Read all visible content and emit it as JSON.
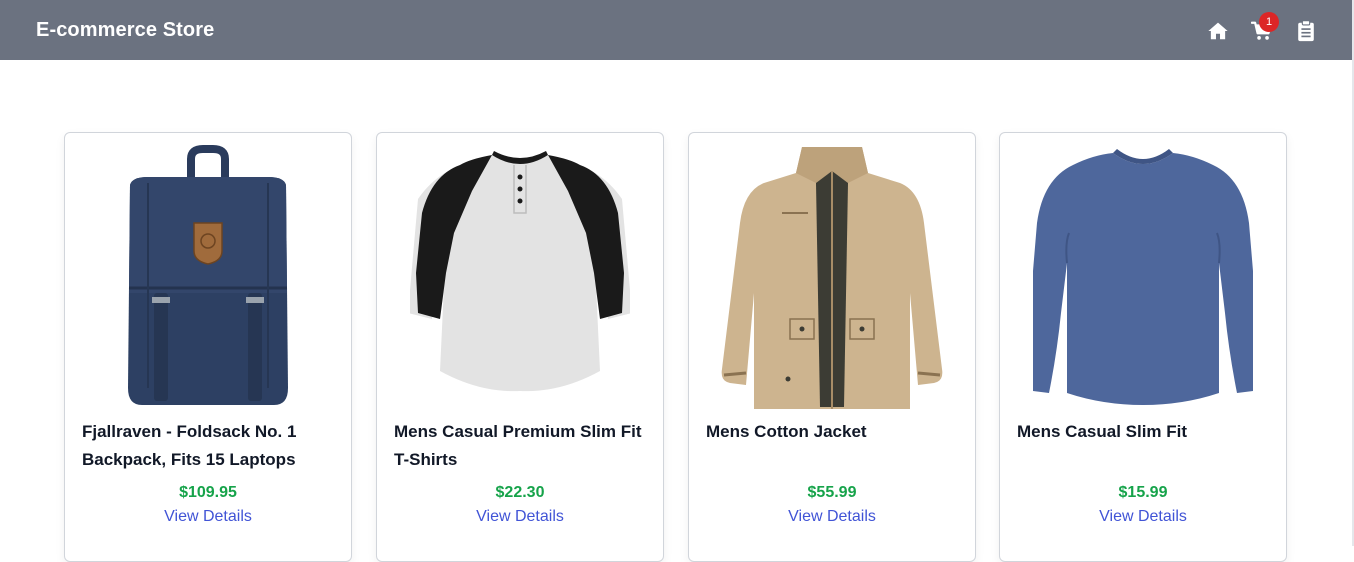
{
  "header": {
    "brand": "E-commerce Store",
    "background_color": "#6b7280",
    "icons": [
      "home-icon",
      "cart-icon",
      "clipboard-icon"
    ],
    "cart_count": "1",
    "badge_color": "#dc2626"
  },
  "products": [
    {
      "title": "Fjallraven - Foldsack No. 1 Backpack, Fits 15 Laptops",
      "price": "$109.95",
      "link_label": "View Details",
      "image": "navy backpack"
    },
    {
      "title": "Mens Casual Premium Slim Fit T-Shirts",
      "price": "$22.30",
      "link_label": "View Details",
      "image": "raglan henley t-shirt"
    },
    {
      "title": "Mens Cotton Jacket",
      "price": "$55.99",
      "link_label": "View Details",
      "image": "khaki cotton jacket"
    },
    {
      "title": "Mens Casual Slim Fit",
      "price": "$15.99",
      "link_label": "View Details",
      "image": "blue long sleeve shirt"
    }
  ],
  "colors": {
    "price": "#16a34a",
    "link": "#4154d6",
    "card_border": "#d1d5db"
  }
}
